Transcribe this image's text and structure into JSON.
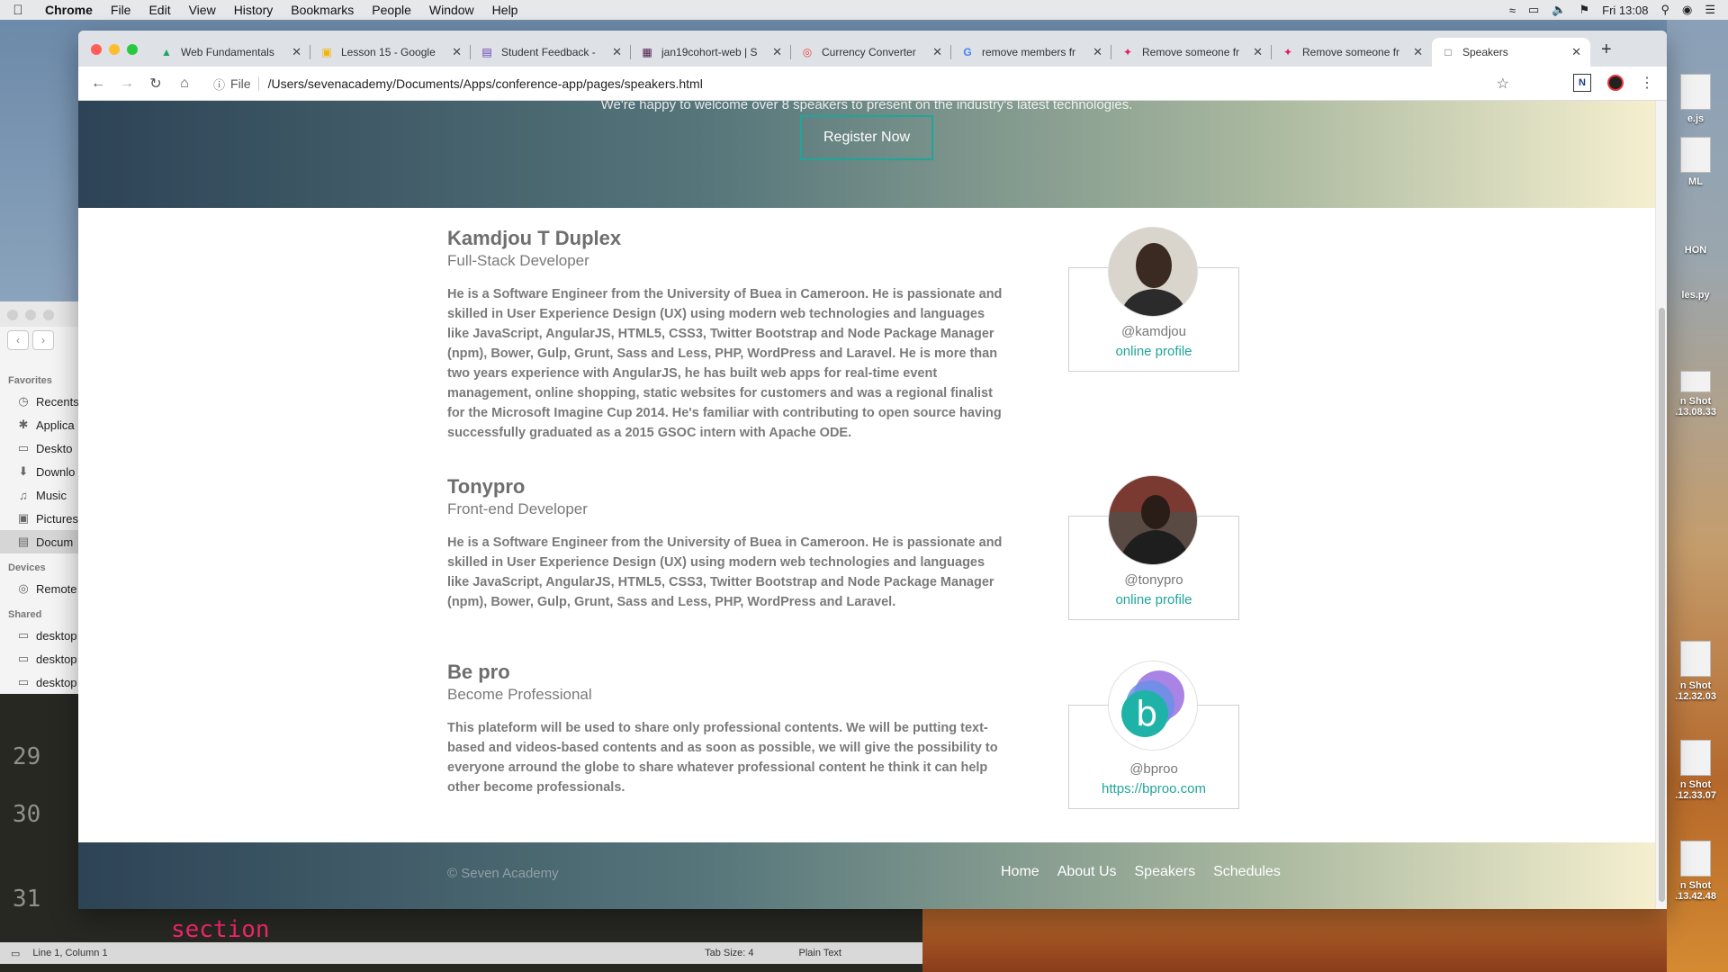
{
  "menubar": {
    "app_name": "Chrome",
    "items": [
      "File",
      "Edit",
      "View",
      "History",
      "Bookmarks",
      "People",
      "Window",
      "Help"
    ],
    "clock": "Fri 13:08"
  },
  "finder": {
    "favorites_header": "Favorites",
    "favorites": [
      {
        "label": "Recents",
        "icon": "clock-icon"
      },
      {
        "label": "Applica",
        "icon": "applications-icon"
      },
      {
        "label": "Deskto",
        "icon": "desktop-icon"
      },
      {
        "label": "Downlo",
        "icon": "download-icon"
      },
      {
        "label": "Music",
        "icon": "music-icon"
      },
      {
        "label": "Pictures",
        "icon": "camera-icon"
      },
      {
        "label": "Docum",
        "icon": "document-icon"
      }
    ],
    "devices_header": "Devices",
    "devices": [
      {
        "label": "Remote",
        "icon": "disc-icon"
      }
    ],
    "shared_header": "Shared",
    "shared": [
      {
        "label": "desktop",
        "icon": "monitor-icon"
      },
      {
        "label": "desktop",
        "icon": "monitor-icon"
      },
      {
        "label": "desktop",
        "icon": "monitor-icon"
      }
    ]
  },
  "editor": {
    "line_numbers": [
      "29",
      "30",
      "31"
    ],
    "code_word": "section",
    "status_position": "Line 1, Column 1",
    "status_tab_size": "Tab Size: 4",
    "status_syntax": "Plain Text"
  },
  "desktop_files": [
    {
      "label": "e.js"
    },
    {
      "label": "ML"
    },
    {
      "label": "HON"
    },
    {
      "label": "les.py"
    },
    {
      "label": "n Shot\n.13.08.33"
    },
    {
      "label": "n Shot\n.12.32.03"
    },
    {
      "label": "n Shot\n.12.33.07"
    },
    {
      "label": "n Shot\n.13.42.48"
    }
  ],
  "browser": {
    "tabs": [
      {
        "title": "Web Fundamentals",
        "icon": "drive-icon",
        "color": "#1fa463"
      },
      {
        "title": "Lesson 15 - Google",
        "icon": "slides-icon",
        "color": "#f4b400"
      },
      {
        "title": "Student Feedback -",
        "icon": "forms-icon",
        "color": "#673ab7"
      },
      {
        "title": "jan19cohort-web | S",
        "icon": "slack-icon",
        "color": "#4a154b"
      },
      {
        "title": "Currency Converter",
        "icon": "target-icon",
        "color": "#e8453c"
      },
      {
        "title": "remove members fr",
        "icon": "google-icon",
        "color": "#4285f4"
      },
      {
        "title": "Remove someone fr",
        "icon": "slack-icon",
        "color": "#e01e5a"
      },
      {
        "title": "Remove someone fr",
        "icon": "slack-icon",
        "color": "#e01e5a"
      },
      {
        "title": "Speakers",
        "icon": "page-icon",
        "color": "#5f6368",
        "active": true
      }
    ],
    "address": {
      "scheme_label": "File",
      "url": "/Users/sevenacademy/Documents/Apps/conference-app/pages/speakers.html"
    }
  },
  "page": {
    "hero_subtitle": "We're happy to welcome over 8 speakers to present on the industry's latest technologies.",
    "register_label": "Register Now",
    "speakers": [
      {
        "name": "Kamdjou T Duplex",
        "role": "Full-Stack Developer",
        "bio": "He is a Software Engineer from the University of Buea in Cameroon. He is passionate and skilled in User Experience Design (UX) using modern web technologies and languages like JavaScript, AngularJS, HTML5, CSS3, Twitter Bootstrap and Node Package Manager (npm), Bower, Gulp, Grunt, Sass and Less, PHP, WordPress and Laravel. He is more than two years experience with AngularJS, he has built web apps for real-time event management, online shopping, static websites for customers and was a regional finalist for the Microsoft Imagine Cup 2014. He's familiar with contributing to open source having successfully graduated as a 2015 GSOC intern with Apache ODE.",
        "handle": "@kamdjou",
        "link": "online profile"
      },
      {
        "name": "Tonypro",
        "role": "Front-end Developer",
        "bio": "He is a Software Engineer from the University of Buea in Cameroon. He is passionate and skilled in User Experience Design (UX) using modern web technologies and languages like JavaScript, AngularJS, HTML5, CSS3, Twitter Bootstrap and Node Package Manager (npm), Bower, Gulp, Grunt, Sass and Less, PHP, WordPress and Laravel.",
        "handle": "@tonypro",
        "link": "online profile"
      },
      {
        "name": "Be pro",
        "role": "Become Professional",
        "bio": "This plateform will be used to share only professional contents. We will be putting text-based and videos-based contents and as soon as possible, we will give the possibility to everyone arround the globe to share whatever professional content he think it can help other become professionals.",
        "handle": "@bproo",
        "link": "https://bproo.com",
        "logo_letter": "b"
      }
    ],
    "footer": {
      "copyright": "© Seven Academy",
      "nav": [
        "Home",
        "About Us",
        "Speakers",
        "Schedules"
      ]
    }
  },
  "colors": {
    "accent": "#1fa59a",
    "hero_start": "#2d4356",
    "hero_end": "#f5efcf"
  }
}
